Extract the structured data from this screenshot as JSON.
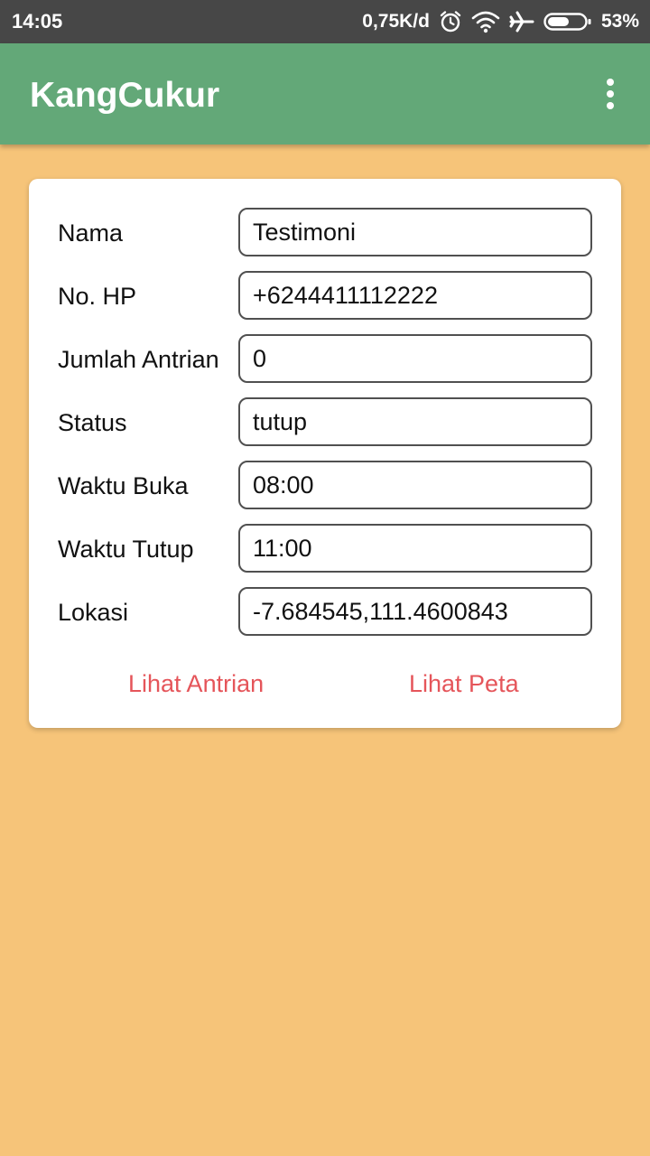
{
  "status_bar": {
    "time": "14:05",
    "net_speed": "0,75K/d",
    "battery": "53%",
    "icons": [
      "alarm-icon",
      "wifi-icon",
      "airplane-icon",
      "battery-icon"
    ]
  },
  "app_bar": {
    "title": "KangCukur",
    "menu_icon": "overflow-menu-icon"
  },
  "form": {
    "fields": [
      {
        "label": "Nama",
        "value": "Testimoni"
      },
      {
        "label": "No. HP",
        "value": "+6244411112222"
      },
      {
        "label": "Jumlah Antrian",
        "value": "0"
      },
      {
        "label": "Status",
        "value": "tutup"
      },
      {
        "label": "Waktu Buka",
        "value": "08:00"
      },
      {
        "label": "Waktu Tutup",
        "value": "11:00"
      },
      {
        "label": "Lokasi",
        "value": "-7.684545,111.4600843"
      }
    ]
  },
  "actions": {
    "view_queue": "Lihat Antrian",
    "view_map": "Lihat Peta"
  },
  "colors": {
    "status_bar": "#474747",
    "app_bar": "#63A878",
    "background": "#F6C479",
    "card": "#FFFFFF",
    "link": "#E5555A"
  }
}
